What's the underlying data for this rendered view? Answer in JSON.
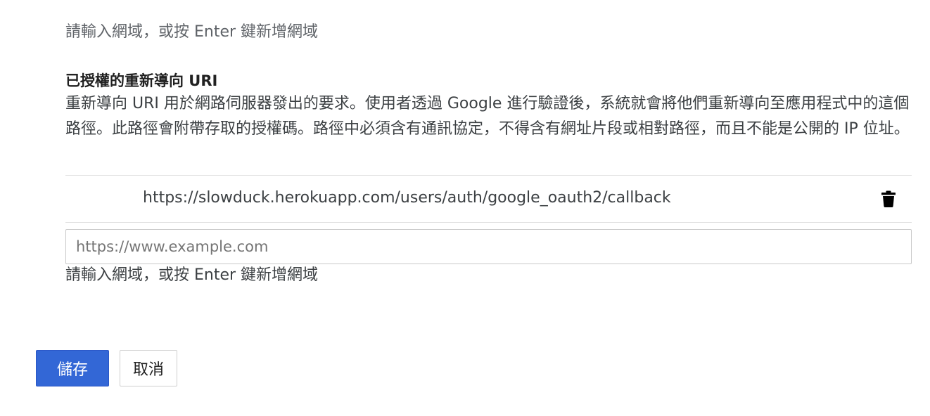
{
  "origins_section": {
    "hint_text_cutoff": "請輸入網域，或按 Enter 鍵新增網域"
  },
  "redirect_section": {
    "title": "已授權的重新導向 URI",
    "description": "重新導向 URI 用於網路伺服器發出的要求。使用者透過 Google 進行驗證後，系統就會將他們重新導向至應用程式中的這個路徑。此路徑會附帶存取的授權碼。路徑中必須含有通訊協定，不得含有網址片段或相對路徑，而且不能是公開的 IP 位址。",
    "uris": [
      {
        "value": "https://slowduck.herokuapp.com/users/auth/google_oauth2/callback",
        "delete_icon": "trash-icon"
      }
    ],
    "input": {
      "value": "",
      "placeholder": "https://www.example.com"
    },
    "hint": "請輸入網域，或按 Enter 鍵新增網域"
  },
  "actions": {
    "save_label": "儲存",
    "cancel_label": "取消"
  },
  "colors": {
    "primary": "#3367d6",
    "divider": "#e0e0e0",
    "text_secondary": "#3c4043"
  }
}
